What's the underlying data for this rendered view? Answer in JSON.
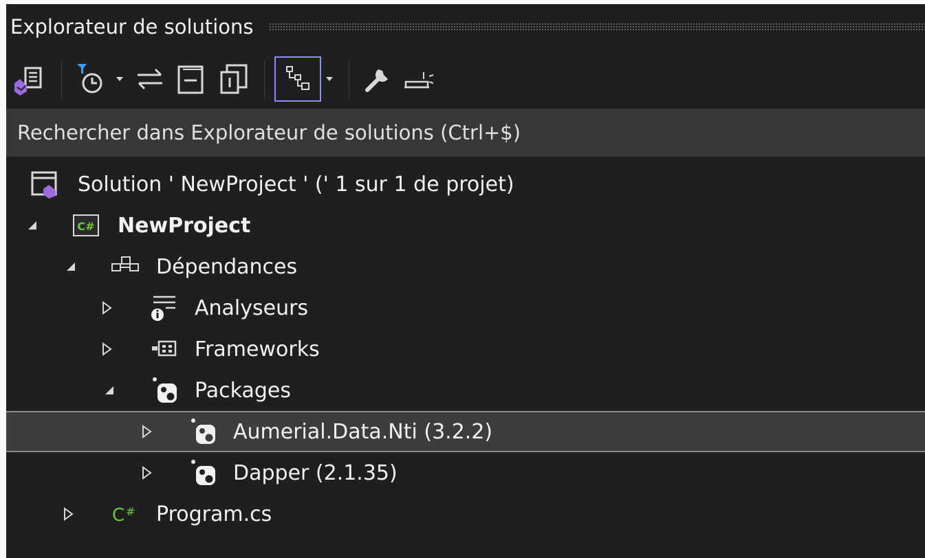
{
  "panel": {
    "title": "Explorateur de solutions"
  },
  "toolbar": {
    "buttons": [
      {
        "icon": "vs-solution-switch-icon"
      },
      {
        "icon": "pending-changes-filter-icon"
      },
      {
        "icon": "sync-with-active-document-icon"
      },
      {
        "icon": "collapse-all-icon"
      },
      {
        "icon": "show-all-files-icon"
      },
      {
        "icon": "switch-views-icon",
        "active": true
      },
      {
        "icon": "properties-wrench-icon"
      },
      {
        "icon": "preview-selected-items-icon"
      }
    ]
  },
  "search": {
    "placeholder": "Rechercher dans Explorateur de solutions (Ctrl+$)"
  },
  "tree": {
    "solution": "Solution ' NewProject ' (' 1 sur 1 de projet)",
    "project": "NewProject",
    "dependencies": "Dépendances",
    "analyzers": "Analyseurs",
    "frameworks": "Frameworks",
    "packages": "Packages",
    "package_1": "Aumerial.Data.Nti (3.2.2)",
    "package_2": "Dapper (2.1.35)",
    "program": "Program.cs"
  },
  "colors": {
    "background": "#1f1f1f",
    "search_bg": "#373737",
    "selected_row": "#3d3d3d",
    "active_button_border": "#8b8bff",
    "csharp_green": "#6cc644",
    "vs_purple": "#9b6bdf"
  }
}
